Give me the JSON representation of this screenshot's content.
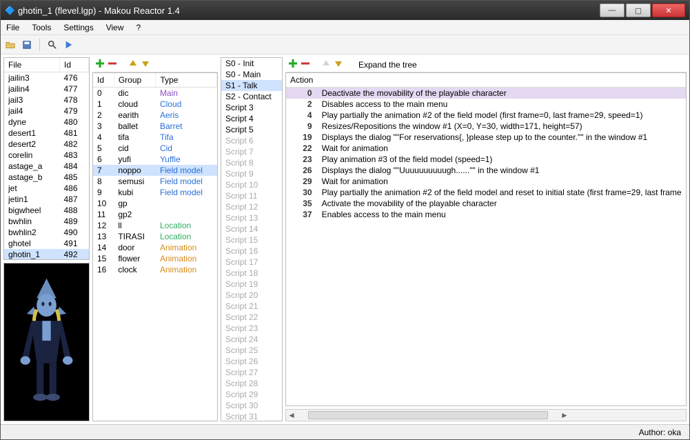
{
  "window": {
    "title": "ghotin_1 (flevel.lgp) - Makou Reactor 1.4"
  },
  "menu": {
    "file": "File",
    "tools": "Tools",
    "settings": "Settings",
    "view": "View",
    "help": "?"
  },
  "filecols": {
    "file": "File",
    "id": "Id"
  },
  "files": [
    {
      "f": "jailin3",
      "i": "476"
    },
    {
      "f": "jailin4",
      "i": "477"
    },
    {
      "f": "jail3",
      "i": "478"
    },
    {
      "f": "jail4",
      "i": "479"
    },
    {
      "f": "dyne",
      "i": "480"
    },
    {
      "f": "desert1",
      "i": "481"
    },
    {
      "f": "desert2",
      "i": "482"
    },
    {
      "f": "corelin",
      "i": "483"
    },
    {
      "f": "astage_a",
      "i": "484"
    },
    {
      "f": "astage_b",
      "i": "485"
    },
    {
      "f": "jet",
      "i": "486"
    },
    {
      "f": "jetin1",
      "i": "487"
    },
    {
      "f": "bigwheel",
      "i": "488"
    },
    {
      "f": "bwhlin",
      "i": "489"
    },
    {
      "f": "bwhlin2",
      "i": "490"
    },
    {
      "f": "ghotel",
      "i": "491"
    },
    {
      "f": "ghotin_1",
      "i": "492",
      "sel": true
    }
  ],
  "groupcols": {
    "id": "Id",
    "group": "Group",
    "type": "Type"
  },
  "groups": [
    {
      "i": "0",
      "g": "dic",
      "t": "Main",
      "c": "c-main"
    },
    {
      "i": "1",
      "g": "cloud",
      "t": "Cloud",
      "c": "c-cloud"
    },
    {
      "i": "2",
      "g": "earith",
      "t": "Aeris",
      "c": "c-aeris"
    },
    {
      "i": "3",
      "g": "ballet",
      "t": "Barret",
      "c": "c-barret"
    },
    {
      "i": "4",
      "g": "tifa",
      "t": "Tifa",
      "c": "c-tifa"
    },
    {
      "i": "5",
      "g": "cid",
      "t": "Cid",
      "c": "c-cid"
    },
    {
      "i": "6",
      "g": "yufi",
      "t": "Yuffie",
      "c": "c-yuffie"
    },
    {
      "i": "7",
      "g": "noppo",
      "t": "Field model",
      "c": "c-field",
      "sel": true
    },
    {
      "i": "8",
      "g": "semusi",
      "t": "Field model",
      "c": "c-field"
    },
    {
      "i": "9",
      "g": "kubi",
      "t": "Field model",
      "c": "c-field"
    },
    {
      "i": "10",
      "g": "gp",
      "t": "",
      "c": ""
    },
    {
      "i": "11",
      "g": "gp2",
      "t": "",
      "c": ""
    },
    {
      "i": "12",
      "g": "ll",
      "t": "Location",
      "c": "c-loc"
    },
    {
      "i": "13",
      "g": "TIRASI",
      "t": "Location",
      "c": "c-loc"
    },
    {
      "i": "14",
      "g": "door",
      "t": "Animation",
      "c": "c-anim"
    },
    {
      "i": "15",
      "g": "flower",
      "t": "Animation",
      "c": "c-anim"
    },
    {
      "i": "16",
      "g": "clock",
      "t": "Animation",
      "c": "c-anim"
    }
  ],
  "scripts": [
    {
      "l": "S0 - Init"
    },
    {
      "l": "S0 - Main"
    },
    {
      "l": "S1 - Talk",
      "sel": true
    },
    {
      "l": "S2 - Contact"
    },
    {
      "l": "Script 3"
    },
    {
      "l": "Script 4"
    },
    {
      "l": "Script 5"
    },
    {
      "l": "Script 6",
      "d": true
    },
    {
      "l": "Script 7",
      "d": true
    },
    {
      "l": "Script 8",
      "d": true
    },
    {
      "l": "Script 9",
      "d": true
    },
    {
      "l": "Script 10",
      "d": true
    },
    {
      "l": "Script 11",
      "d": true
    },
    {
      "l": "Script 12",
      "d": true
    },
    {
      "l": "Script 13",
      "d": true
    },
    {
      "l": "Script 14",
      "d": true
    },
    {
      "l": "Script 15",
      "d": true
    },
    {
      "l": "Script 16",
      "d": true
    },
    {
      "l": "Script 17",
      "d": true
    },
    {
      "l": "Script 18",
      "d": true
    },
    {
      "l": "Script 19",
      "d": true
    },
    {
      "l": "Script 20",
      "d": true
    },
    {
      "l": "Script 21",
      "d": true
    },
    {
      "l": "Script 22",
      "d": true
    },
    {
      "l": "Script 23",
      "d": true
    },
    {
      "l": "Script 24",
      "d": true
    },
    {
      "l": "Script 25",
      "d": true
    },
    {
      "l": "Script 26",
      "d": true
    },
    {
      "l": "Script 27",
      "d": true
    },
    {
      "l": "Script 28",
      "d": true
    },
    {
      "l": "Script 29",
      "d": true
    },
    {
      "l": "Script 30",
      "d": true
    },
    {
      "l": "Script 31",
      "d": true
    }
  ],
  "rightbar": {
    "expand": "Expand the tree"
  },
  "actioncol": "Action",
  "actions": [
    {
      "i": "0",
      "t": "Deactivate the movability of the playable character",
      "sel": true
    },
    {
      "i": "2",
      "t": "Disables access to the main menu"
    },
    {
      "i": "4",
      "t": "Play partially the animation #2 of the field model (first frame=0, last frame=29, speed=1)"
    },
    {
      "i": "9",
      "t": "Resizes/Repositions the window #1 (X=0, Y=30, width=171, height=57)"
    },
    {
      "i": "19",
      "t": "Displays the dialog \"\"For reservations{, }please step up to the counter.\"\" in the window #1"
    },
    {
      "i": "22",
      "t": "Wait for animation"
    },
    {
      "i": "23",
      "t": "Play animation #3 of the field model (speed=1)"
    },
    {
      "i": "26",
      "t": "Displays the dialog \"\"Uuuuuuuuuugh......\"\" in the window #1"
    },
    {
      "i": "29",
      "t": "Wait for animation"
    },
    {
      "i": "30",
      "t": "Play partially the animation #2 of the field model and reset to initial state (first frame=29, last frame"
    },
    {
      "i": "35",
      "t": "Activate the movability of the playable character"
    },
    {
      "i": "37",
      "t": "Enables access to the main menu"
    }
  ],
  "status": {
    "author": "Author: oka"
  }
}
